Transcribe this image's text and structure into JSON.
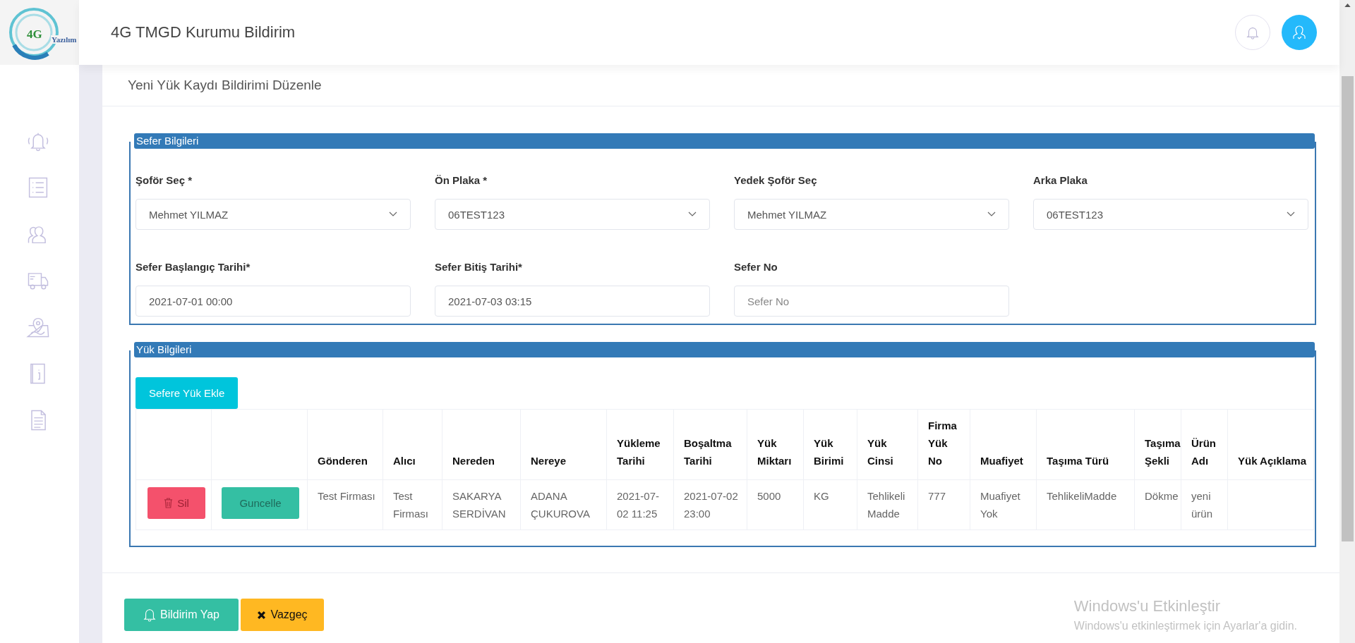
{
  "header": {
    "logo_mark": "4G",
    "logo_word": "Yazılım",
    "title": "4G TMGD Kurumu Bildirim"
  },
  "page_title": "Yeni Yük Kaydı Bildirimi Düzenle",
  "trip": {
    "legend": "Sefer Bilgileri",
    "fields": [
      {
        "label": "Şoför Seç *",
        "kind": "select",
        "value": "Mehmet YILMAZ"
      },
      {
        "label": "Ön Plaka *",
        "kind": "select",
        "value": "06TEST123"
      },
      {
        "label": "Yedek Şoför Seç",
        "kind": "select",
        "value": "Mehmet YILMAZ"
      },
      {
        "label": "Arka Plaka",
        "kind": "select",
        "value": "06TEST123"
      },
      {
        "label": "Sefer Başlangıç Tarihi*",
        "kind": "input",
        "value": "2021-07-01 00:00"
      },
      {
        "label": "Sefer Bitiş Tarihi*",
        "kind": "input",
        "value": "2021-07-03 03:15"
      },
      {
        "label": "Sefer No",
        "kind": "input",
        "placeholder": "Sefer No"
      }
    ]
  },
  "cargo": {
    "legend": "Yük Bilgileri",
    "add_button": "Sefere Yük Ekle",
    "columns": [
      "Gönderen",
      "Alıcı",
      "Nereden",
      "Nereye",
      "Yükleme Tarihi",
      "Boşaltma Tarihi",
      "Yük Miktarı",
      "Yük Birimi",
      "Yük Cinsi",
      "Firma Yük No",
      "Muafiyet",
      "Taşıma Türü",
      "Taşıma Şekli",
      "Ürün Adı",
      "Yük Açıklama"
    ],
    "rows": [
      {
        "delete": "Sil",
        "update": "Guncelle",
        "cells": [
          "Test Firması",
          "Test Firması",
          "SAKARYA SERDİVAN",
          "ADANA ÇUKUROVA",
          "2021-07-02 11:25",
          "2021-07-02 23:00",
          "5000",
          "KG",
          "Tehlikeli Madde",
          "777",
          "Muafiyet Yok",
          "TehlikeliMadde",
          "Dökme",
          "yeni ürün",
          ""
        ]
      }
    ]
  },
  "actions": [
    {
      "kind": "submit",
      "label": "Bildirim Yap"
    },
    {
      "kind": "cancel",
      "label": "Vazgeç"
    }
  ],
  "os_notice": {
    "title": "Windows'u Etkinleştir",
    "text": "Windows'u etkinleştirmek için Ayarlar'a gidin."
  }
}
